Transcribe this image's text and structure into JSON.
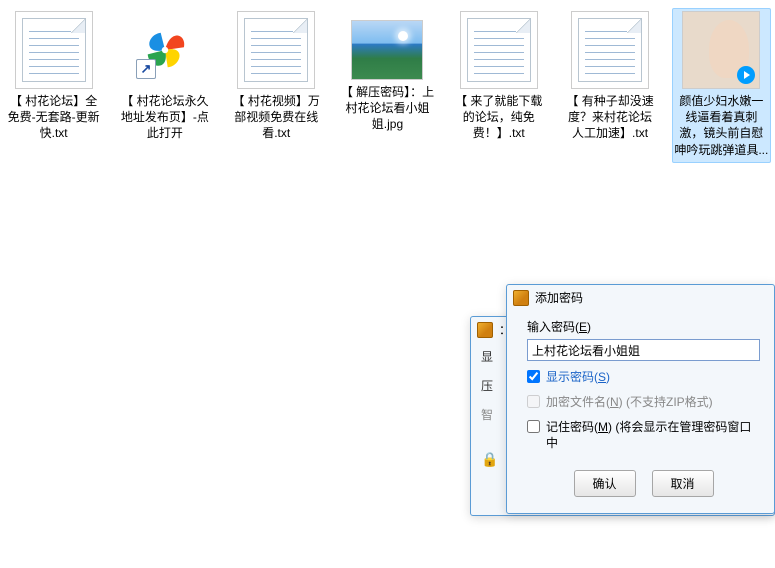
{
  "files": [
    {
      "name": "txt1",
      "label": "【 村花论坛】全免费-无套路-更新快.txt",
      "type": "txt"
    },
    {
      "name": "shortcut",
      "label": "【 村花论坛永久地址发布页】-点此打开",
      "type": "pinwheel"
    },
    {
      "name": "txt2",
      "label": "【 村花视频】万部视频免费在线看.txt",
      "type": "txt"
    },
    {
      "name": "jpg",
      "label": "【 解压密码】：上村花论坛看小姐姐.jpg",
      "type": "photo"
    },
    {
      "name": "txt3",
      "label": "【 来了就能下载的论坛，纯免费！】.txt",
      "type": "txt"
    },
    {
      "name": "txt4",
      "label": "【 有种子却没速度？来村花论坛人工加速】.txt",
      "type": "txt"
    },
    {
      "name": "video",
      "label": "颜值少妇水嫩一线逼看着真刺激，镜头前自慰呻吟玩跳弹道具...",
      "type": "video",
      "selected": true
    }
  ],
  "back_dialog": {
    "title": "：",
    "row1_label": "显",
    "row2_prefix": "压",
    "row3_prefix": "智"
  },
  "front_dialog": {
    "title": "添加密码",
    "input_label_pre": "输入密码(",
    "input_label_u": "E",
    "input_label_post": ")",
    "input_value": "上村花论坛看小姐姐",
    "check1_pre": "显示密码(",
    "check1_u": "S",
    "check1_post": ")",
    "check2_pre": "加密文件名(",
    "check2_u": "N",
    "check2_post": ") (不支持ZIP格式)",
    "check3_pre": "记住密码(",
    "check3_u": "M",
    "check3_post": ") (将会显示在管理密码窗口中",
    "ok": "确认",
    "cancel": "取消"
  }
}
